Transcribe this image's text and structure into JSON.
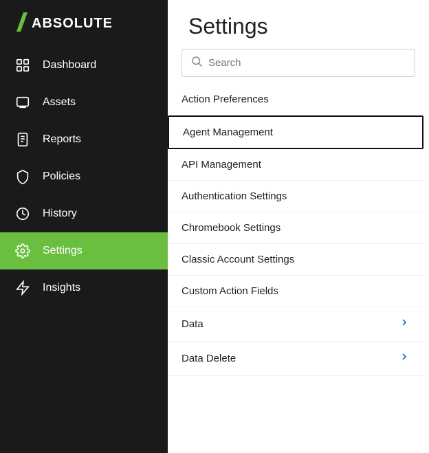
{
  "logo": {
    "icon": "/",
    "text": "ABSOLUTE"
  },
  "sidebar": {
    "items": [
      {
        "id": "dashboard",
        "label": "Dashboard",
        "active": false
      },
      {
        "id": "assets",
        "label": "Assets",
        "active": false
      },
      {
        "id": "reports",
        "label": "Reports",
        "active": false
      },
      {
        "id": "policies",
        "label": "Policies",
        "active": false
      },
      {
        "id": "history",
        "label": "History",
        "active": false
      },
      {
        "id": "settings",
        "label": "Settings",
        "active": true
      },
      {
        "id": "insights",
        "label": "Insights",
        "active": false
      }
    ]
  },
  "main": {
    "title": "Settings",
    "search": {
      "placeholder": "Search"
    },
    "menu_items": [
      {
        "id": "action-preferences",
        "label": "Action Preferences",
        "has_chevron": false,
        "selected": false
      },
      {
        "id": "agent-management",
        "label": "Agent Management",
        "has_chevron": false,
        "selected": true
      },
      {
        "id": "api-management",
        "label": "API Management",
        "has_chevron": false,
        "selected": false
      },
      {
        "id": "authentication-settings",
        "label": "Authentication Settings",
        "has_chevron": false,
        "selected": false
      },
      {
        "id": "chromebook-settings",
        "label": "Chromebook Settings",
        "has_chevron": false,
        "selected": false
      },
      {
        "id": "classic-account-settings",
        "label": "Classic Account Settings",
        "has_chevron": false,
        "selected": false
      },
      {
        "id": "custom-action-fields",
        "label": "Custom Action Fields",
        "has_chevron": false,
        "selected": false
      },
      {
        "id": "data",
        "label": "Data",
        "has_chevron": true,
        "selected": false
      },
      {
        "id": "data-delete",
        "label": "Data Delete",
        "has_chevron": true,
        "selected": false
      }
    ]
  }
}
